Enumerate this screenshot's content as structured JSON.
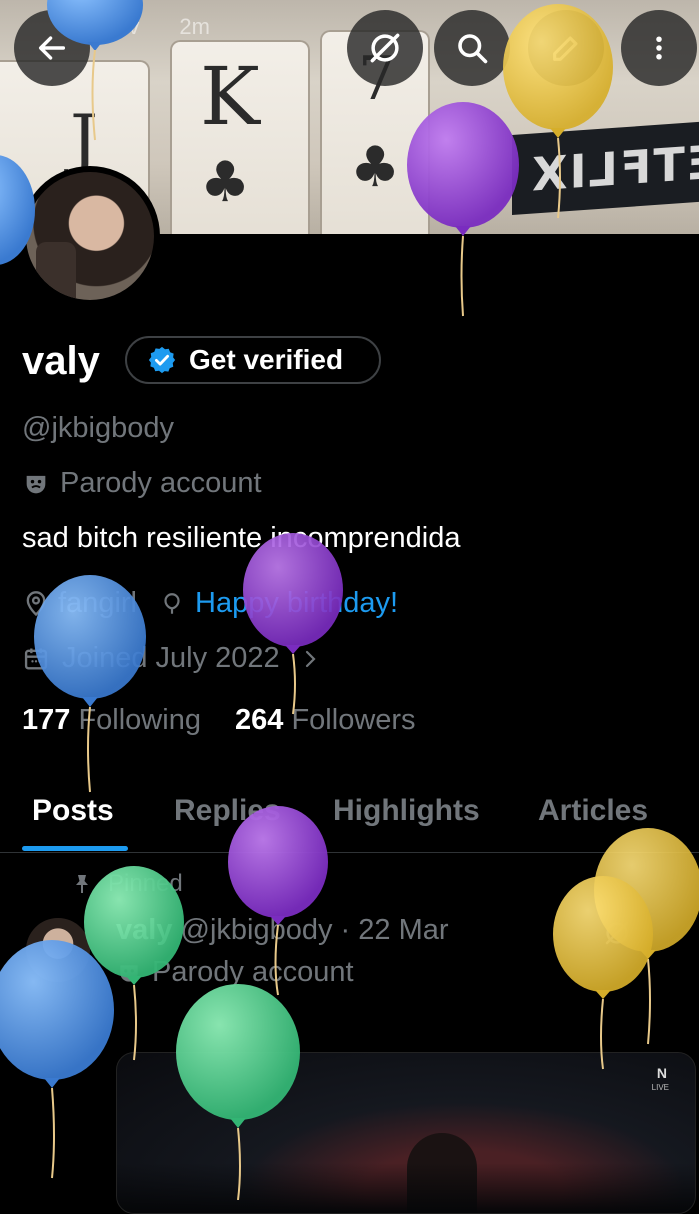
{
  "header": {
    "top_user": "thv",
    "top_time": "2m",
    "back_icon": "arrow-left-icon",
    "grok_icon": "grok-icon",
    "search_icon": "search-icon",
    "edit_icon": "pencil-icon",
    "more_icon": "more-vertical-icon"
  },
  "profile": {
    "name": "valy",
    "verify_label": "Get verified",
    "handle": "@jkbigbody",
    "parody_label": "Parody account",
    "bio": "sad bitch resiliente incomprendida",
    "location": "fangirl",
    "birthday": "Happy birthday!",
    "joined": "Joined July 2022",
    "following_count": "177",
    "following_label": "Following",
    "followers_count": "264",
    "followers_label": "Followers"
  },
  "tabs": [
    {
      "label": "Posts",
      "active": true
    },
    {
      "label": "Replies",
      "active": false
    },
    {
      "label": "Highlights",
      "active": false
    },
    {
      "label": "Articles",
      "active": false
    }
  ],
  "post": {
    "pinned_label": "Pinned",
    "author": "valy",
    "meta": "@jkbigbody · 22 Mar",
    "parody_label": "Parody account",
    "media_logo": "N",
    "media_live": "LIVE"
  },
  "colors": {
    "accent": "#1d9bf0",
    "muted": "#71767b",
    "balloon_blue": "#4a8fe0",
    "balloon_purple": "#8b3fd0",
    "balloon_green": "#4cd08a",
    "balloon_yellow": "#e9c43a"
  }
}
